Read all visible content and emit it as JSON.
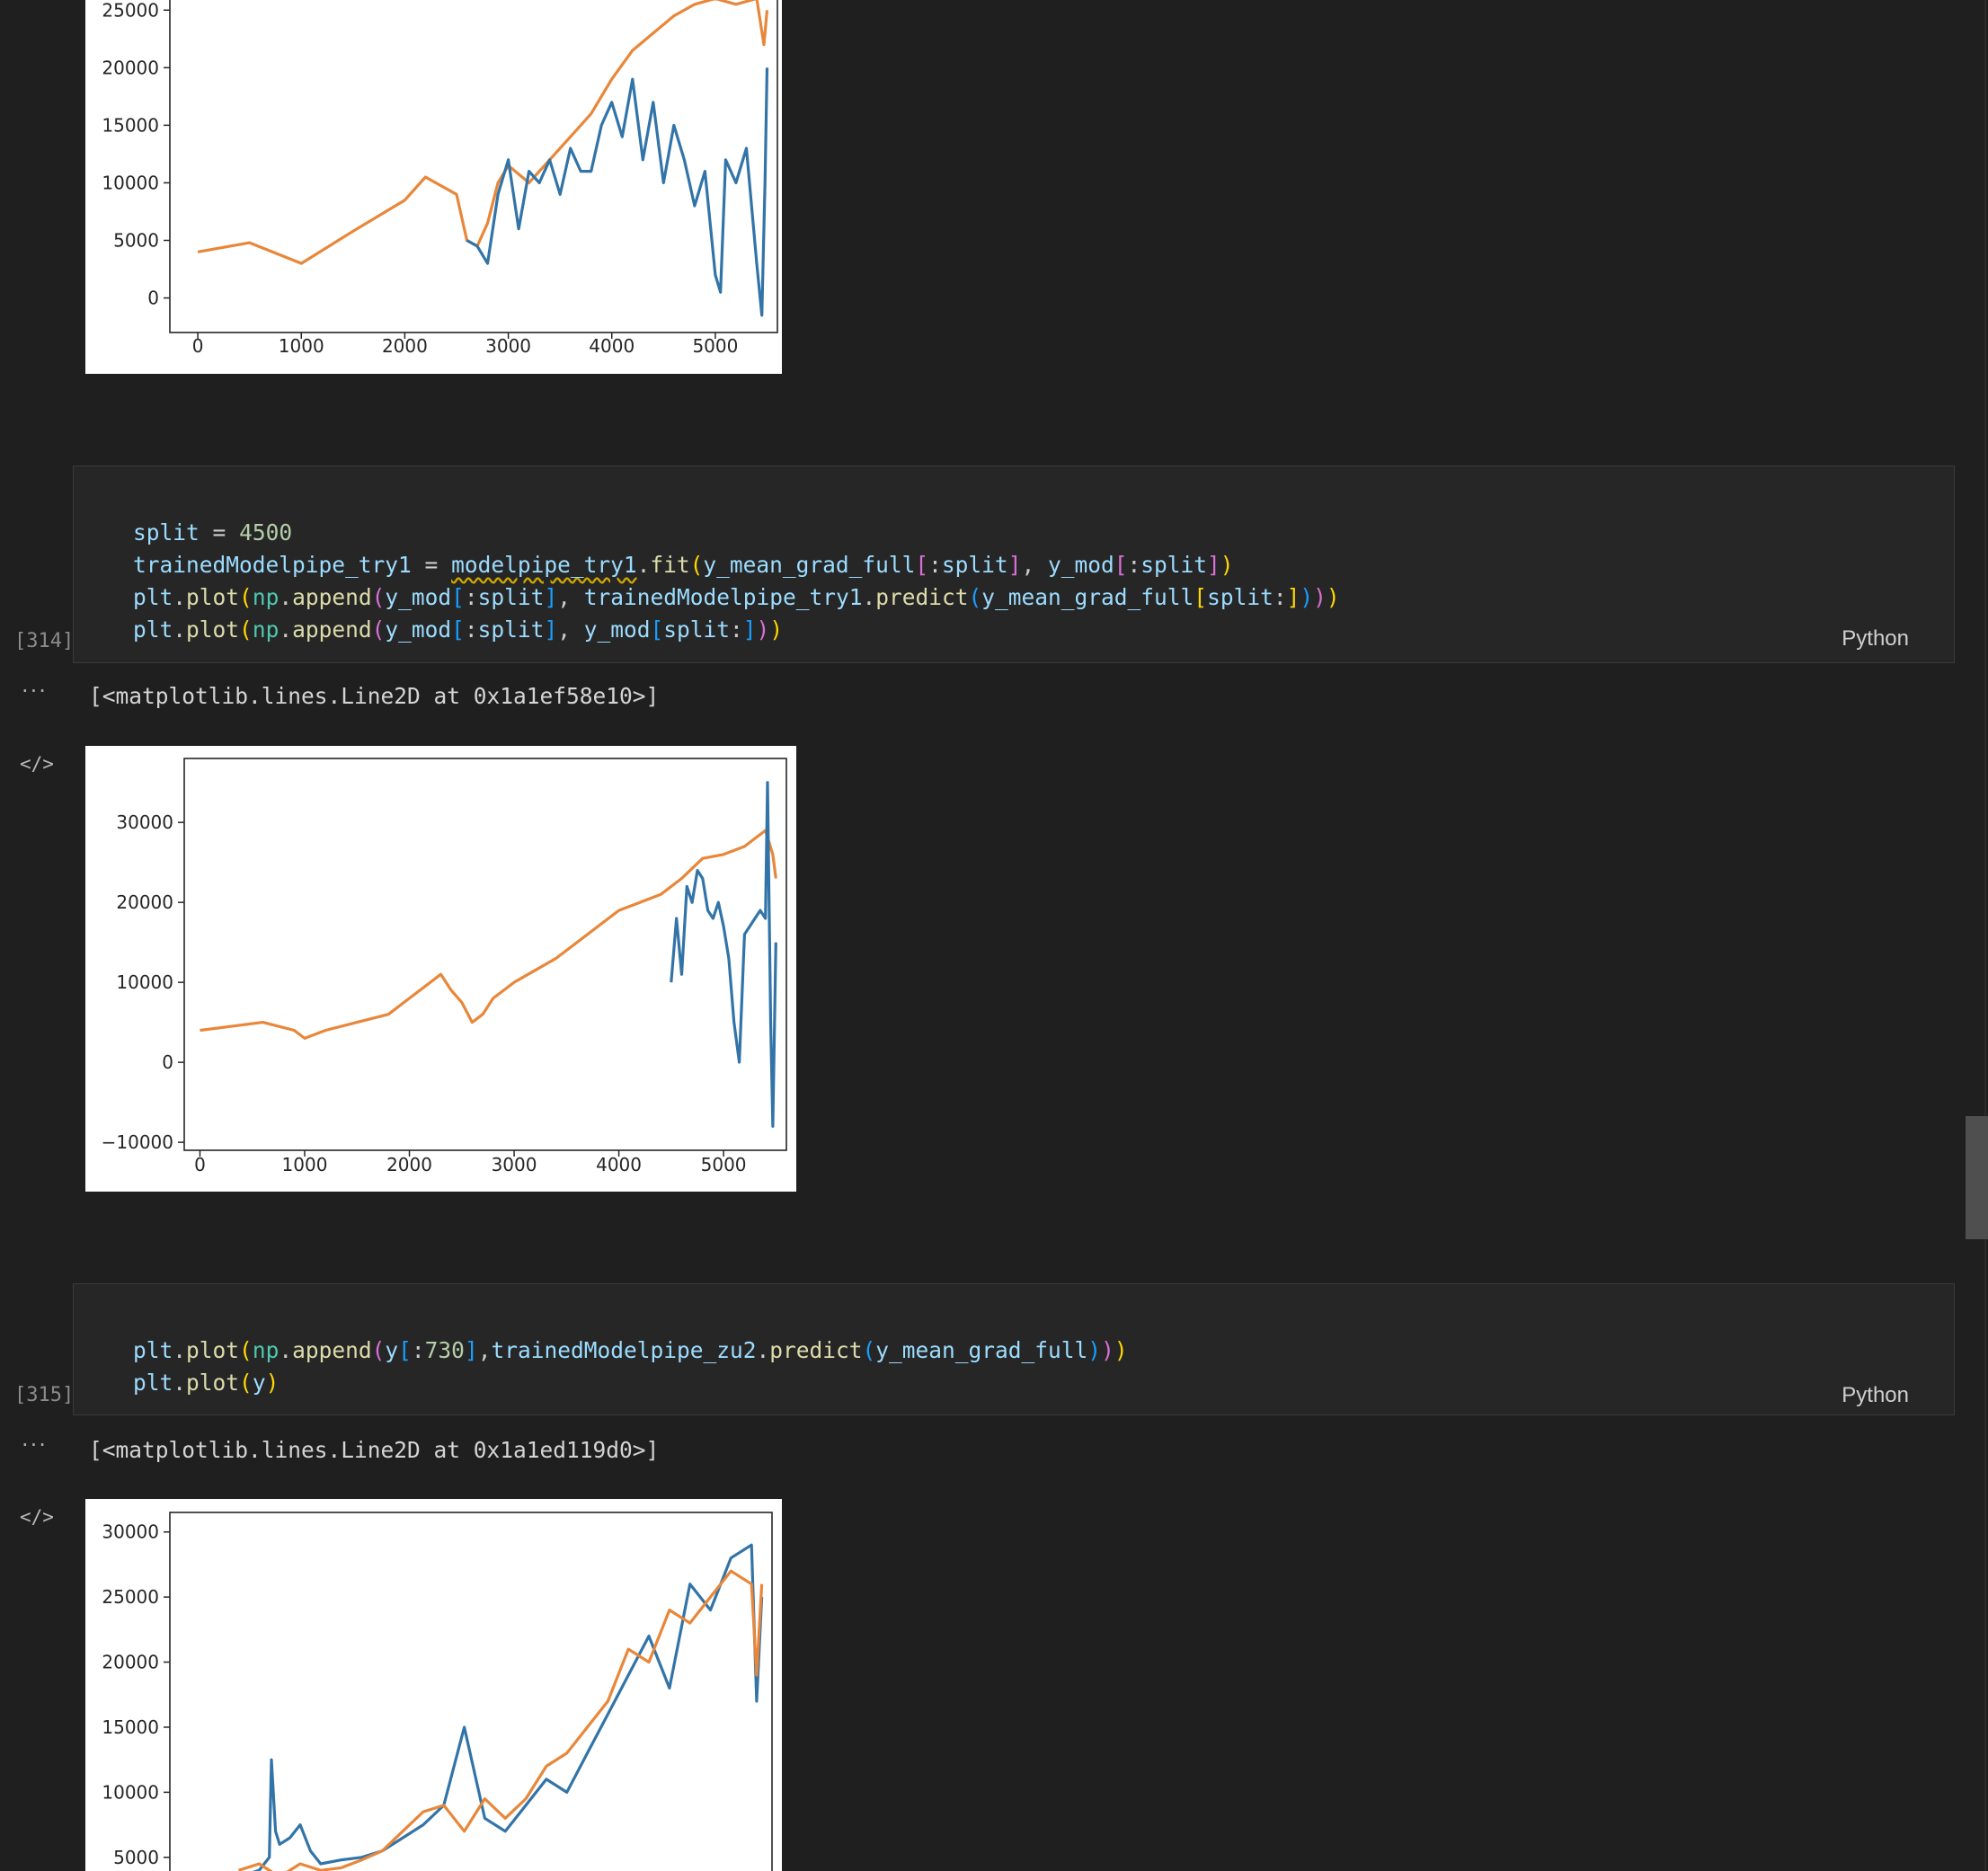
{
  "cells": [
    {
      "exec_count": "[314]",
      "language": "Python",
      "code_lines": [
        "split = 4500",
        "trainedModelpipe_try1 = modelpipe_try1.fit(y_mean_grad_full[:split], y_mod[:split])",
        "plt.plot(np.append(y_mod[:split], trainedModelpipe_try1.predict(y_mean_grad_full[split:])))",
        "plt.plot(np.append(y_mod[:split], y_mod[split:]))"
      ],
      "output_text": "[<matplotlib.lines.Line2D at 0x1a1ef58e10>]"
    },
    {
      "exec_count": "[315]",
      "language": "Python",
      "code_lines": [
        "plt.plot(np.append(y[:730],trainedModelpipe_zu2.predict(y_mean_grad_full)))",
        "plt.plot(y)"
      ],
      "output_text": "[<matplotlib.lines.Line2D at 0x1a1ed119d0>]"
    }
  ],
  "output_more_icon": "ellipsis-icon",
  "output_code_icon": "</>",
  "colors": {
    "series_blue": "#3274a8",
    "series_orange": "#e8873a",
    "background": "#1f1f1f"
  },
  "chart_data": [
    {
      "type": "line",
      "yticks": [
        "0",
        "5000",
        "10000",
        "15000",
        "20000",
        "25000"
      ],
      "xticks": [
        "0",
        "1000",
        "2000",
        "3000",
        "4000",
        "5000"
      ],
      "series": [
        {
          "x": [
            0,
            500,
            1000,
            1500,
            2000,
            2200,
            2500,
            2600,
            2700,
            2800,
            2900,
            3000,
            3200,
            3400,
            3600,
            3800,
            4000,
            4200,
            4400,
            4600,
            4800,
            5000,
            5200,
            5400,
            5470,
            5500
          ],
          "values": [
            4000,
            4800,
            3000,
            5800,
            8500,
            10500,
            9000,
            5000,
            4500,
            6500,
            10000,
            11500,
            10000,
            12000,
            14000,
            16000,
            19000,
            21500,
            23000,
            24500,
            25500,
            26000,
            25500,
            26000,
            22000,
            25000
          ]
        },
        {
          "x": [
            2600,
            2700,
            2800,
            2900,
            3000,
            3100,
            3200,
            3300,
            3400,
            3500,
            3600,
            3700,
            3800,
            3900,
            4000,
            4100,
            4200,
            4300,
            4400,
            4500,
            4600,
            4700,
            4800,
            4900,
            5000,
            5050,
            5100,
            5200,
            5300,
            5400,
            5450,
            5480,
            5500
          ],
          "values": [
            5000,
            4500,
            3000,
            9000,
            12000,
            6000,
            11000,
            10000,
            12000,
            9000,
            13000,
            11000,
            11000,
            15000,
            17000,
            14000,
            19000,
            12000,
            17000,
            10000,
            15000,
            12000,
            8000,
            11000,
            2000,
            500,
            12000,
            10000,
            13000,
            3000,
            -1500,
            10000,
            20000
          ]
        }
      ]
    },
    {
      "type": "line",
      "yticks": [
        "−10000",
        "0",
        "10000",
        "20000",
        "30000"
      ],
      "xticks": [
        "0",
        "1000",
        "2000",
        "3000",
        "4000",
        "5000"
      ],
      "series": [
        {
          "x": [
            0,
            300,
            600,
            900,
            1000,
            1200,
            1500,
            1800,
            2000,
            2200,
            2300,
            2400,
            2500,
            2600,
            2700,
            2800,
            2900,
            3000,
            3200,
            3400,
            3600,
            3800,
            4000,
            4200,
            4400,
            4600,
            4800,
            5000,
            5200,
            5300,
            5400,
            5470,
            5500
          ],
          "values": [
            4000,
            4500,
            5000,
            4000,
            3000,
            4000,
            5000,
            6000,
            8000,
            10000,
            11000,
            9000,
            7500,
            5000,
            6000,
            8000,
            9000,
            10000,
            11500,
            13000,
            15000,
            17000,
            19000,
            20000,
            21000,
            23000,
            25500,
            26000,
            27000,
            28000,
            29000,
            26000,
            23000
          ]
        },
        {
          "x": [
            4500,
            4550,
            4600,
            4650,
            4700,
            4750,
            4800,
            4850,
            4900,
            4950,
            5000,
            5050,
            5100,
            5150,
            5200,
            5250,
            5300,
            5350,
            5400,
            5420,
            5450,
            5470,
            5500
          ],
          "values": [
            10000,
            18000,
            11000,
            22000,
            20000,
            24000,
            23000,
            19000,
            18000,
            20000,
            17000,
            13000,
            5000,
            0,
            16000,
            17000,
            18000,
            19000,
            18000,
            35000,
            5000,
            -8000,
            15000
          ]
        }
      ]
    },
    {
      "type": "line",
      "yticks": [
        "5000",
        "10000",
        "15000",
        "20000",
        "25000",
        "30000"
      ],
      "xticks": [],
      "series": [
        {
          "x": [
            400,
            600,
            800,
            1000,
            1200,
            1400,
            1600,
            1800,
            2000,
            2200,
            2400,
            2600,
            2800,
            3000,
            3200,
            3400,
            3600,
            3800,
            4000,
            4200,
            4400,
            4600,
            4800,
            5000,
            5200,
            5400,
            5450,
            5500
          ],
          "values": [
            4000,
            4500,
            3500,
            4500,
            4000,
            4200,
            4800,
            5500,
            7000,
            8500,
            9000,
            7000,
            9500,
            8000,
            9500,
            12000,
            13000,
            15000,
            17000,
            21000,
            20000,
            24000,
            23000,
            25000,
            27000,
            26000,
            19000,
            26000
          ]
        },
        {
          "x": [
            400,
            600,
            700,
            720,
            760,
            800,
            900,
            1000,
            1100,
            1200,
            1400,
            1600,
            1800,
            2000,
            2200,
            2400,
            2600,
            2800,
            3000,
            3200,
            3400,
            3600,
            3800,
            4000,
            4200,
            4400,
            4600,
            4800,
            5000,
            5200,
            5400,
            5450,
            5500
          ],
          "values": [
            3500,
            4000,
            5000,
            12500,
            7000,
            6000,
            6500,
            7500,
            5500,
            4500,
            4800,
            5000,
            5500,
            6500,
            7500,
            9000,
            15000,
            8000,
            7000,
            9000,
            11000,
            10000,
            13000,
            16000,
            19000,
            22000,
            18000,
            26000,
            24000,
            28000,
            29000,
            17000,
            25000
          ]
        }
      ]
    }
  ]
}
